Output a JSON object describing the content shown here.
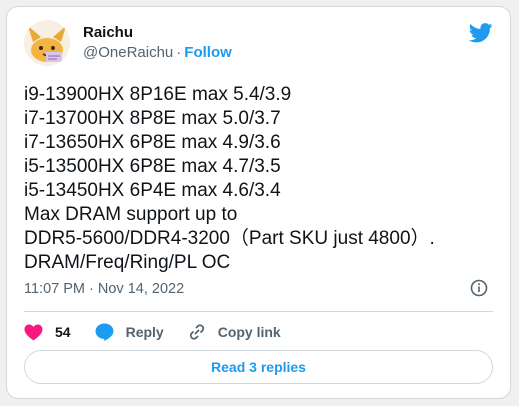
{
  "author": {
    "name": "Raichu",
    "handle": "@OneRaichu",
    "separator": "·",
    "follow_label": "Follow"
  },
  "tweet": {
    "lines": [
      "i9-13900HX 8P16E max 5.4/3.9",
      "i7-13700HX 8P8E max 5.0/3.7",
      "i7-13650HX 6P8E max 4.9/3.6",
      "i5-13500HX 6P8E max 4.7/3.5",
      "i5-13450HX 6P4E max 4.6/3.4",
      "Max DRAM support up to",
      "DDR5-5600/DDR4-3200（Part SKU just 4800）.",
      "DRAM/Freq/Ring/PL OC"
    ],
    "timestamp": "11:07 PM · Nov 14, 2022"
  },
  "actions": {
    "like_count": "54",
    "reply_label": "Reply",
    "copy_link_label": "Copy link"
  },
  "read_replies_label": "Read 3 replies",
  "colors": {
    "accent": "#1d9bf0",
    "like": "#f91880",
    "text": "#0f1419",
    "secondary": "#536471",
    "border": "#cfd9de"
  },
  "icons": [
    "avatar-raichu",
    "twitter-bird-icon",
    "info-icon",
    "heart-icon",
    "reply-icon",
    "copy-link-icon"
  ]
}
